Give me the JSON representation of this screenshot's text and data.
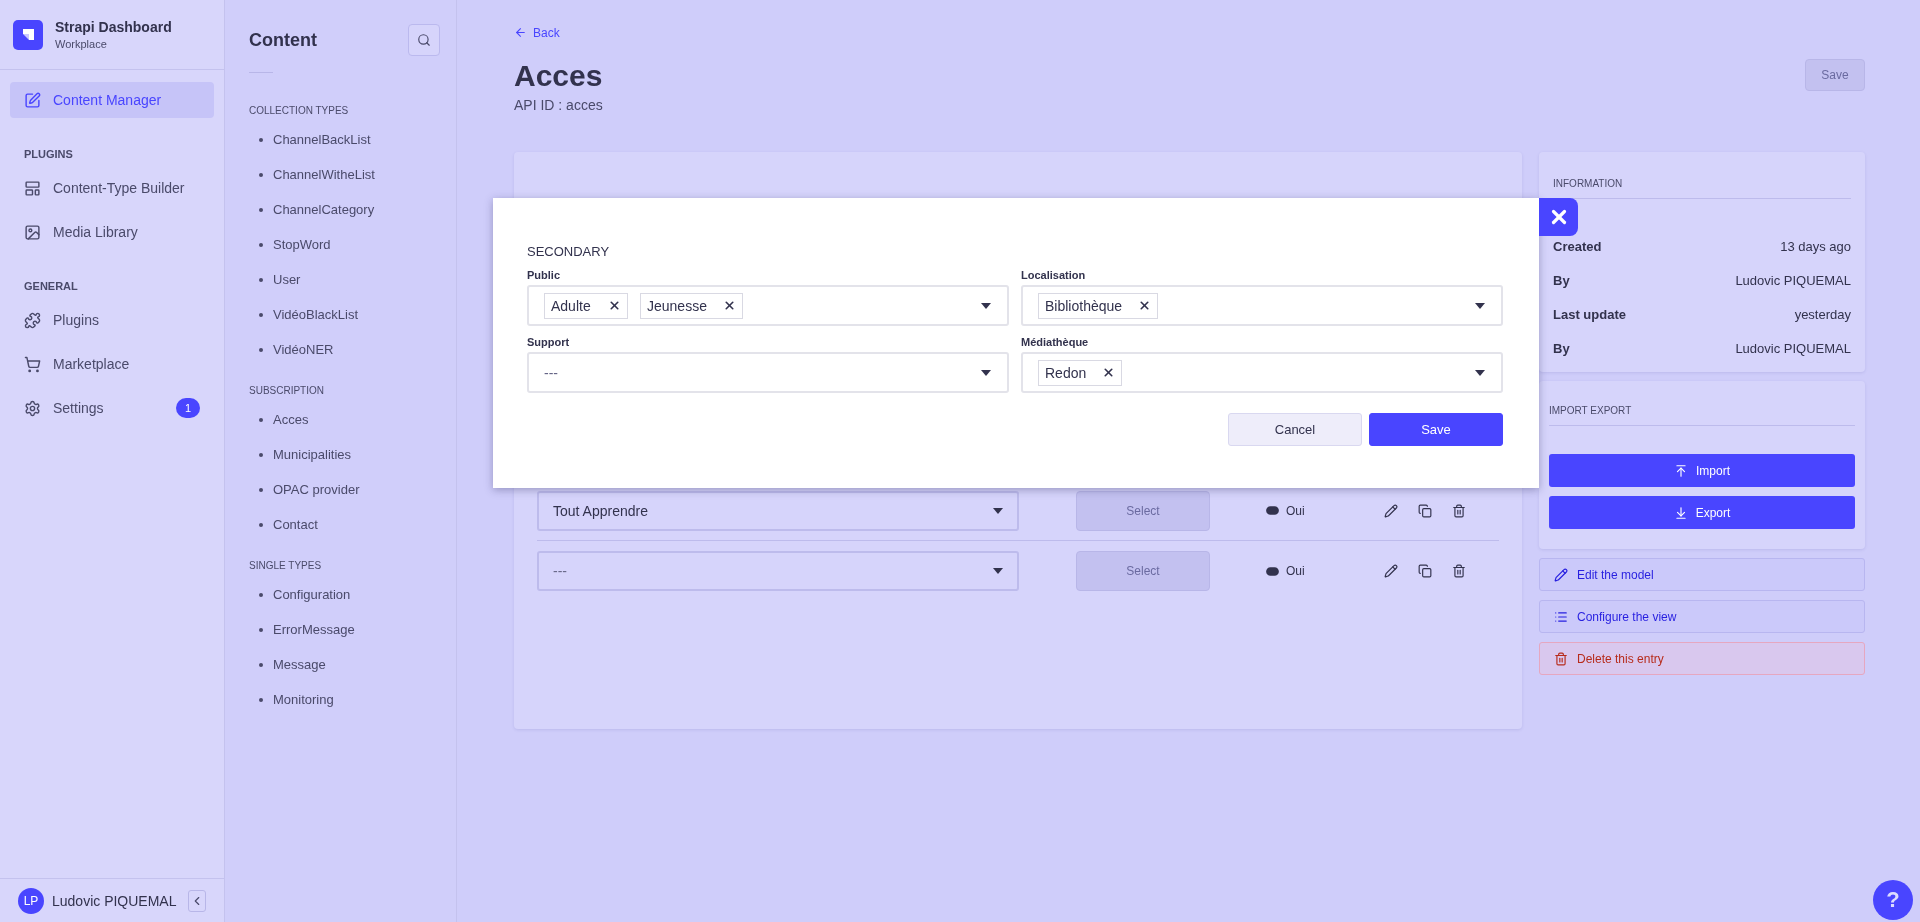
{
  "nav": {
    "brand": {
      "title": "Strapi Dashboard",
      "subtitle": "Workplace"
    },
    "groups": [
      {
        "items": [
          {
            "label": "Content Manager",
            "selected": true
          }
        ]
      },
      {
        "heading": "PLUGINS",
        "items": [
          {
            "label": "Content-Type Builder",
            "selected": false
          },
          {
            "label": "Media Library",
            "selected": false
          }
        ]
      },
      {
        "heading": "GENERAL",
        "items": [
          {
            "label": "Plugins",
            "selected": false
          },
          {
            "label": "Marketplace",
            "selected": false
          },
          {
            "label": "Settings",
            "selected": false,
            "badge": "1"
          }
        ]
      }
    ],
    "user": {
      "initials": "LP",
      "name": "Ludovic PIQUEMAL"
    }
  },
  "content_sidebar": {
    "title": "Content",
    "sections": [
      {
        "heading": "COLLECTION TYPES",
        "items": [
          "ChannelBackList",
          "ChannelWitheList",
          "ChannelCategory",
          "StopWord",
          "User",
          "VidéoBlackList",
          "VidéoNER"
        ]
      },
      {
        "heading": "SUBSCRIPTION",
        "items": [
          "Acces",
          "Municipalities",
          "OPAC provider",
          "Contact"
        ]
      },
      {
        "heading": "SINGLE TYPES",
        "items": [
          "Configuration",
          "ErrorMessage",
          "Message",
          "Monitoring"
        ]
      }
    ]
  },
  "header": {
    "back": "Back",
    "title": "Acces",
    "subtitle": "API ID : acces",
    "save": "Save"
  },
  "table": {
    "rows": [
      {
        "value": "Tout Apprendre",
        "empty": false,
        "button": "Select",
        "toggle": {
          "on": true,
          "label": "Oui"
        }
      },
      {
        "value": "---",
        "empty": true,
        "button": "Select",
        "toggle": {
          "on": true,
          "label": "Oui"
        }
      }
    ]
  },
  "modal": {
    "section": "SECONDARY",
    "fields": [
      {
        "label": "Public",
        "tags": [
          "Adulte",
          "Jeunesse"
        ]
      },
      {
        "label": "Localisation",
        "tags": [
          "Bibliothèque"
        ]
      },
      {
        "label": "Support",
        "value": "---"
      },
      {
        "label": "Médiathèque",
        "tags": [
          "Redon"
        ]
      }
    ],
    "buttons": [
      {
        "label": "Cancel",
        "kind": "secondary"
      },
      {
        "label": "Save",
        "kind": "primary"
      }
    ]
  },
  "information": {
    "heading": "INFORMATION",
    "rows": [
      {
        "label": "Created",
        "value": "13 days ago"
      },
      {
        "label": "By",
        "value": "Ludovic PIQUEMAL"
      },
      {
        "label": "Last update",
        "value": "yesterday"
      },
      {
        "label": "By",
        "value": "Ludovic PIQUEMAL"
      }
    ]
  },
  "import_export": {
    "heading": "IMPORT EXPORT",
    "buttons": [
      {
        "label": "Import",
        "kind": "import"
      },
      {
        "label": "Export",
        "kind": "export"
      }
    ]
  },
  "actions": [
    {
      "label": "Edit the model",
      "kind": "edit"
    },
    {
      "label": "Configure the view",
      "kind": "configure"
    },
    {
      "label": "Delete this entry",
      "kind": "danger"
    }
  ],
  "help": "?"
}
